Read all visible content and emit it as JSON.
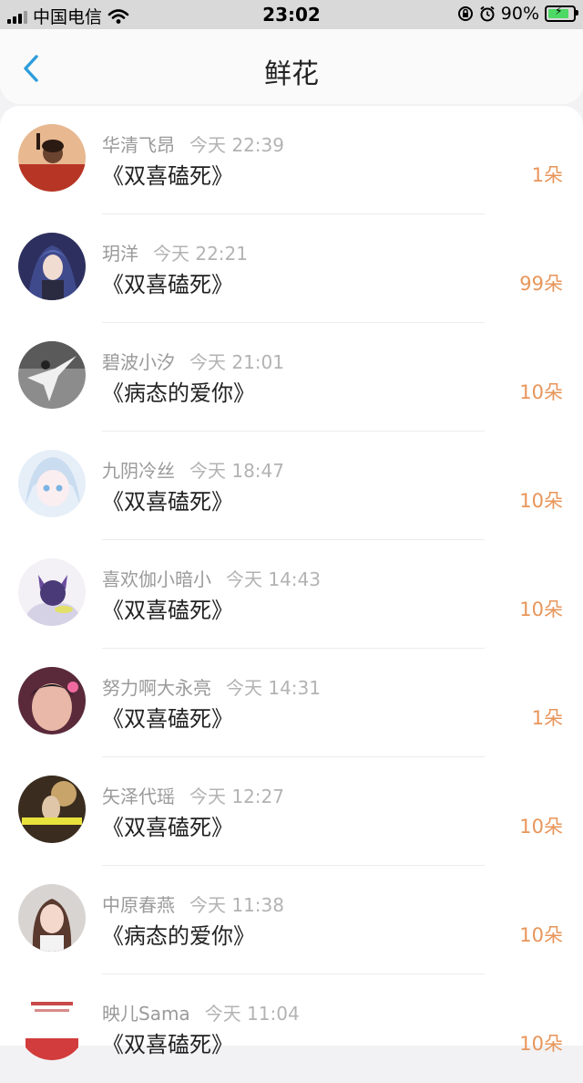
{
  "status_bar": {
    "carrier": "中国电信",
    "time": "23:02",
    "battery": "90%",
    "battery_level": 0.9,
    "icons": [
      "signal-icon",
      "wifi-icon",
      "rotation-lock-icon",
      "alarm-icon",
      "battery-icon"
    ]
  },
  "nav": {
    "back_icon": "chevron-left-icon",
    "title": "鲜花"
  },
  "colors": {
    "accent": "#2d9cdb",
    "count": "#e8955a",
    "name": "#9a9a9a",
    "book": "#222222"
  },
  "records": [
    {
      "name": "华清飞昂",
      "time": "今天 22:39",
      "book": "《双喜磕死》",
      "count": "1朵"
    },
    {
      "name": "玥洋",
      "time": "今天 22:21",
      "book": "《双喜磕死》",
      "count": "99朵"
    },
    {
      "name": "碧波小汐",
      "time": "今天 21:01",
      "book": "《病态的爱你》",
      "count": "10朵"
    },
    {
      "name": "九阴冷丝",
      "time": "今天 18:47",
      "book": "《双喜磕死》",
      "count": "10朵"
    },
    {
      "name": "喜欢伽小暗小",
      "time": "今天 14:43",
      "book": "《双喜磕死》",
      "count": "10朵"
    },
    {
      "name": "努力啊大永亮",
      "time": "今天 14:31",
      "book": "《双喜磕死》",
      "count": "1朵"
    },
    {
      "name": "矢泽代瑶",
      "time": "今天 12:27",
      "book": "《双喜磕死》",
      "count": "10朵"
    },
    {
      "name": "中原春燕",
      "time": "今天 11:38",
      "book": "《病态的爱你》",
      "count": "10朵"
    },
    {
      "name": "映儿Sama",
      "time": "今天 11:04",
      "book": "《双喜磕死》",
      "count": "10朵"
    }
  ]
}
